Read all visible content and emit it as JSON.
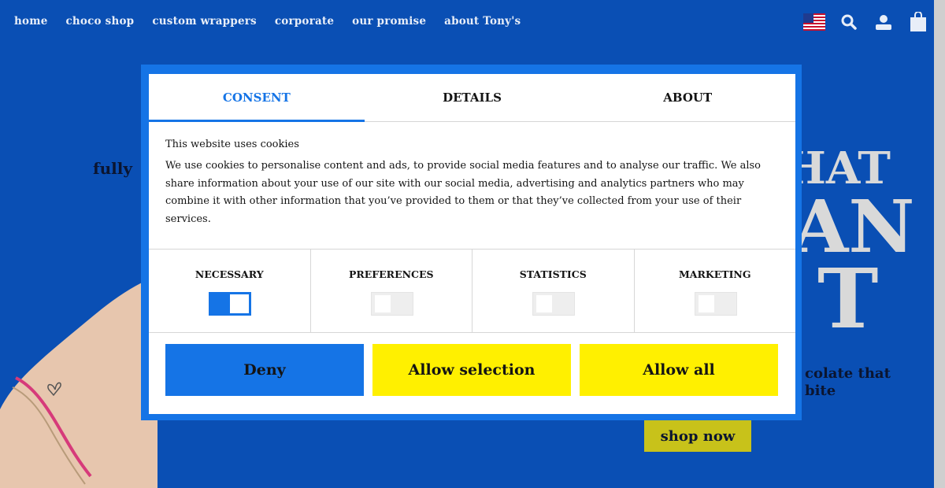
{
  "nav": {
    "links": [
      "home",
      "choco shop",
      "custom wrappers",
      "corporate",
      "our promise",
      "about Tony's"
    ],
    "icons": [
      "us-flag-icon",
      "search-icon",
      "user-icon",
      "shopping-bag-icon"
    ]
  },
  "hero": {
    "left_text": "fully",
    "big_text": [
      "HAT",
      "AN",
      "T"
    ],
    "subtitle": [
      "colate that",
      "bite"
    ],
    "shop_button": "shop now"
  },
  "consent": {
    "tabs": [
      {
        "label": "CONSENT",
        "active": true
      },
      {
        "label": "DETAILS",
        "active": false
      },
      {
        "label": "ABOUT",
        "active": false
      }
    ],
    "title": "This website uses cookies",
    "body": "We use cookies to personalise content and ads, to provide social media features and to analyse our traffic. We also share information about your use of our site with our social media, advertising and analytics partners who may combine it with other information that you’ve provided to them or that they’ve collected from your use of their services.",
    "categories": [
      {
        "label": "NECESSARY",
        "checked": true
      },
      {
        "label": "PREFERENCES",
        "checked": false
      },
      {
        "label": "STATISTICS",
        "checked": false
      },
      {
        "label": "MARKETING",
        "checked": false
      }
    ],
    "buttons": {
      "deny": "Deny",
      "allow_selection": "Allow selection",
      "allow_all": "Allow all"
    }
  },
  "colors": {
    "background": "#0a4fb4",
    "accent": "#1574e6",
    "button_yellow": "#fff000"
  }
}
